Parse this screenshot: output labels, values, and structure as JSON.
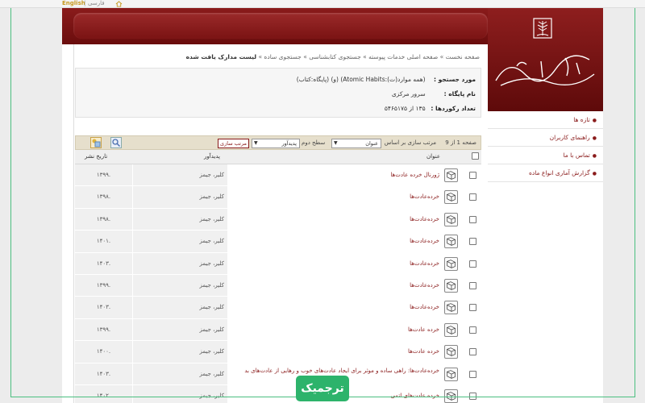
{
  "top": {
    "lang_en": "English",
    "lang_sep": "|",
    "lang_fa": "فارسی"
  },
  "sidebar": {
    "items": [
      {
        "label": "تازه ها"
      },
      {
        "label": "راهنمای کاربران"
      },
      {
        "label": "تماس با ما"
      },
      {
        "label": "گزارش آماری انواع ماده"
      }
    ]
  },
  "breadcrumb": {
    "items": [
      "صفحه نخست",
      "صفحه اصلی خدمات پیوسته",
      "جستجوی کتابشناسی",
      "جستجوی ساده"
    ],
    "sep": "»",
    "current": "لیست مدارک یافت شده"
  },
  "info": {
    "query_label": "مورد جستجو :",
    "query_value": "(همه موارد(ت):Atomic Habits) (و) (پایگاه:کتاب)",
    "db_label": "نام پایگاه :",
    "db_value": "سرور مرکزی",
    "count_label": "تعداد رکوردها :",
    "count_value": "۱۳۵ از ۵۴۶۵۱۷۵"
  },
  "toolbar": {
    "page_text": "صفحه  1 از   9",
    "sort_by_text": "مرتب سازی بر اساس",
    "sort_field": "عنوان",
    "level2_text": "سطح دوم",
    "sort_field2": "پدیدآور",
    "sort_button": "مرتب سازی"
  },
  "columns": {
    "title": "عنوان",
    "publisher": "پدیدآور",
    "date": "تاریخ نشر"
  },
  "rows": [
    {
      "title": "ژورنال خرده عادت‌ها",
      "pub": "کلیر، جیمز",
      "date": "۱۳۹۹."
    },
    {
      "title": "خرده‌عادت‌ها",
      "pub": "کلیر، جیمز",
      "date": "۱۳۹۸."
    },
    {
      "title": "خرده‌عادت‌ها",
      "pub": "کلیر، جیمز",
      "date": "۱۳۹۸."
    },
    {
      "title": "خرده‌عادت‌ها",
      "pub": "کلیر، جیمز",
      "date": "۱۴۰۱."
    },
    {
      "title": "خرده‌عادت‌ها",
      "pub": "کلیر، جیمز",
      "date": "۱۴۰۳."
    },
    {
      "title": "خرده‌عادت‌ها",
      "pub": "کلیر، جیمز",
      "date": "۱۳۹۹."
    },
    {
      "title": "خرده‌عادت‌ها",
      "pub": "کلیر، جیمز",
      "date": "۱۴۰۳."
    },
    {
      "title": "خرده عادت‌ها",
      "pub": "کلیر، جیمز",
      "date": "۱۳۹۹."
    },
    {
      "title": "خرده عادت‌ها",
      "pub": "کلیر، جیمز",
      "date": "۱۴۰۰."
    },
    {
      "title": "خرده‌عادت‌ها: راهی ساده و موثر برای ایجاد عادت‌های خوب و رهایی از عادت‌های بد",
      "pub": "کلیر، جیمز",
      "date": "۱۴۰۳."
    },
    {
      "title": "خرده عادت‌های اتمی",
      "pub": "کلیر، جیمز",
      "date": "۱۴۰۲."
    }
  ],
  "watermark": "ترجمیک",
  "colors": {
    "brand": "#8a1b1b",
    "accent_green": "#2db36b"
  }
}
